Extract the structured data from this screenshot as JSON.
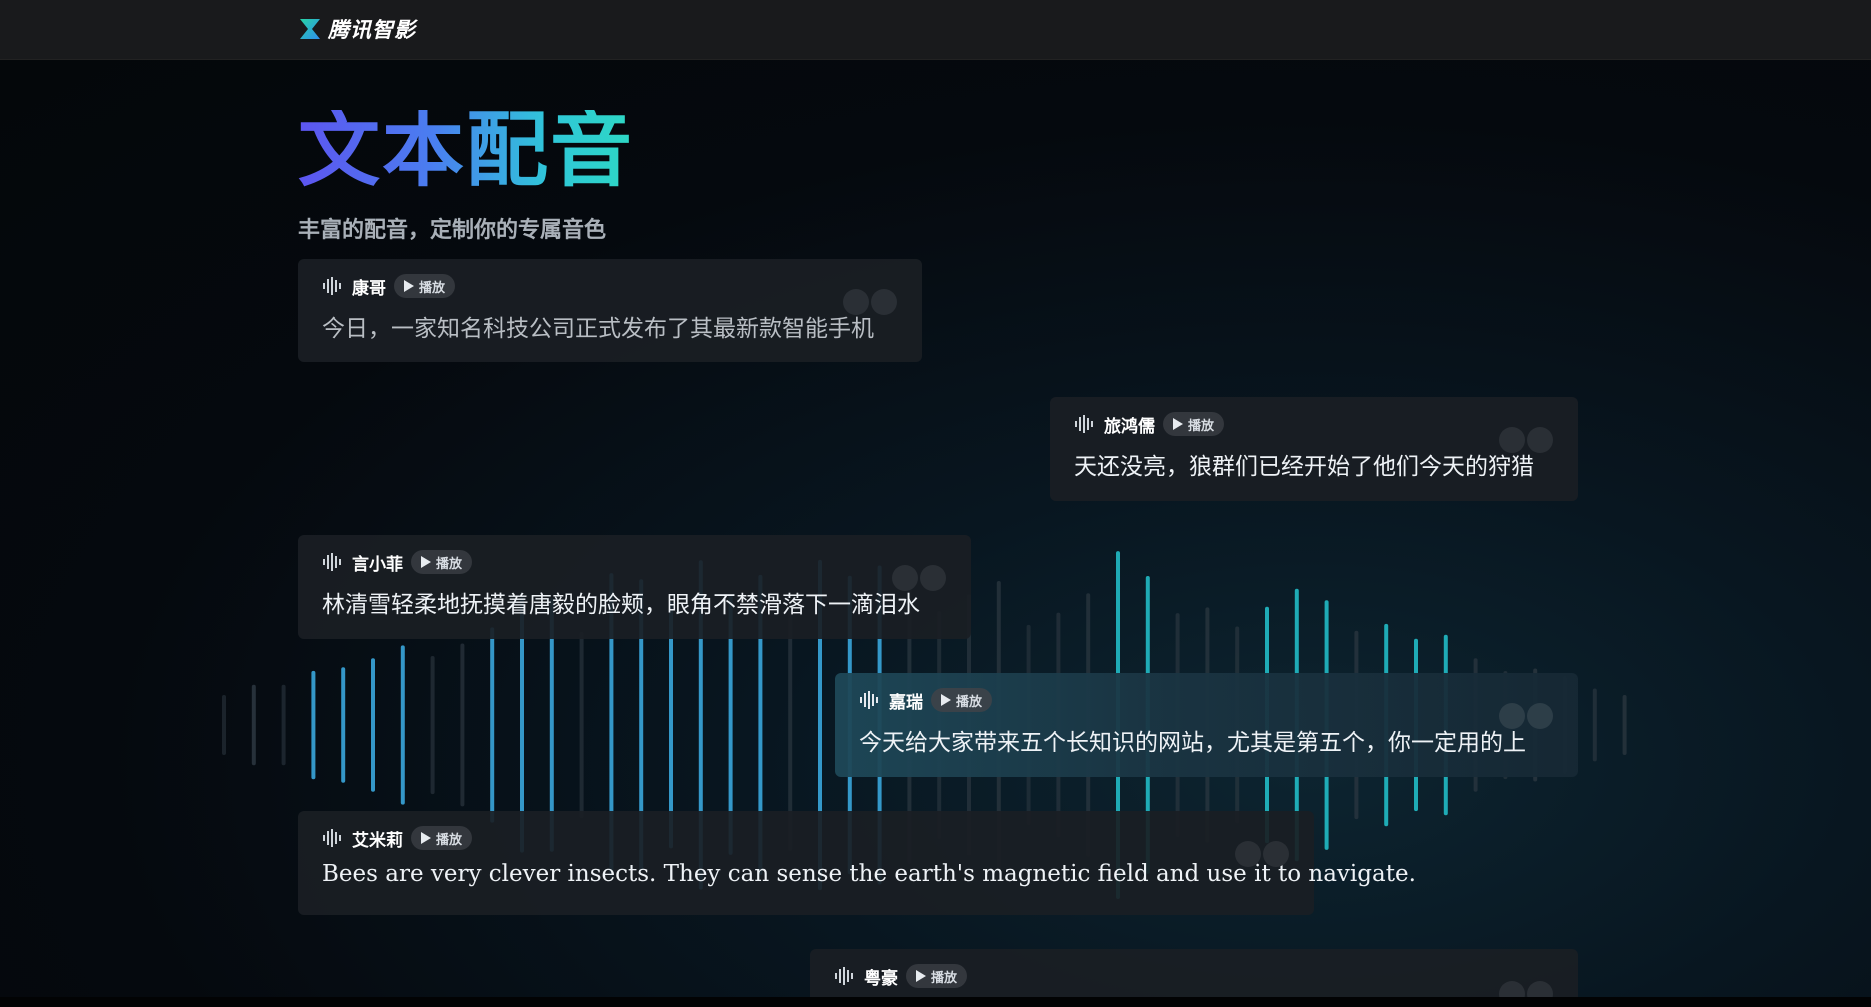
{
  "brand": {
    "name": "腾讯智影",
    "logo_icon": "hourglass-logo-icon",
    "accent": "#2fd6b5"
  },
  "hero": {
    "title": "文本配音",
    "subtitle": "丰富的配音，定制你的专属音色",
    "gradient": [
      "#5d55f0",
      "#2ed8c4"
    ]
  },
  "cards": [
    {
      "speaker": "康哥",
      "play_label": "播放",
      "text": "今日，一家知名科技公司正式发布了其最新款智能手机"
    },
    {
      "speaker": "旅鸿儒",
      "play_label": "播放",
      "text": "天还没亮，狼群们已经开始了他们今天的狩猎"
    },
    {
      "speaker": "言小菲",
      "play_label": "播放",
      "text": "林清雪轻柔地抚摸着唐毅的脸颊，眼角不禁滑落下一滴泪水"
    },
    {
      "speaker": "嘉瑞",
      "play_label": "播放",
      "text": "今天给大家带来五个长知识的网站，尤其是第五个，你一定用的上"
    },
    {
      "speaker": "艾米莉",
      "play_label": "播放",
      "text": "Bees are very clever insects. They can sense the earth's magnetic field and use it to navigate."
    },
    {
      "speaker": "粤豪",
      "play_label": "播放",
      "text": ""
    }
  ],
  "icons": {
    "voice": "voice-wave-icon",
    "play": "play-icon",
    "quote": "quote-mark-icon"
  },
  "colors": {
    "wave_blue": "#3aa6dc",
    "wave_teal": "#23c4cf",
    "wave_grey": "#2e3942"
  }
}
